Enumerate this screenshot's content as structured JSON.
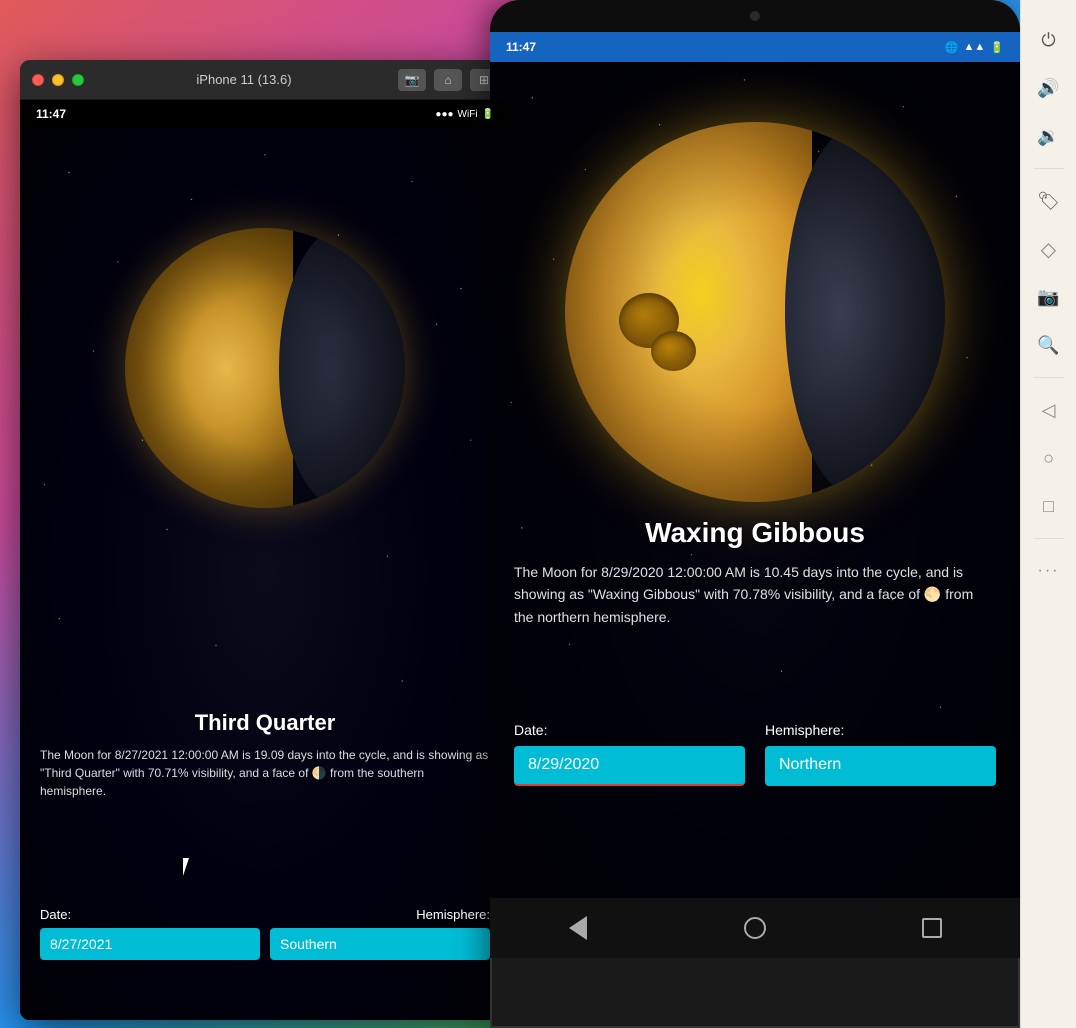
{
  "desktop": {
    "bg_description": "colorful gradient desktop background"
  },
  "ios_simulator": {
    "title": "iPhone 11 (13.6)",
    "screenshot_btn": "📷",
    "home_btn": "⌂",
    "apps_btn": "⊞",
    "status_time": "11:47",
    "moon_phase": "Third Quarter",
    "moon_description": "The Moon for 8/27/2021 12:00:00 AM is 19.09 days into the cycle, and is showing as \"Third Quarter\" with 70.71% visibility, and a face of 🌗  from the southern hemisphere.",
    "date_label": "Date:",
    "hemisphere_label": "Hemisphere:",
    "date_value": "8/27/2021",
    "hemisphere_value": "Southern"
  },
  "android_device": {
    "status_time": "11:47",
    "moon_phase": "Waxing Gibbous",
    "moon_description": "The Moon for 8/29/2020 12:00:00 AM is 10.45 days into the cycle, and is showing as \"Waxing Gibbous\" with 70.78% visibility, and a face of 🌕  from the northern hemisphere.",
    "date_label": "Date:",
    "hemisphere_label": "Hemisphere:",
    "date_value": "8/29/2020",
    "hemisphere_value": "Northern"
  },
  "toolbar": {
    "power_icon": "⏻",
    "volume_up_icon": "🔊",
    "volume_down_icon": "🔉",
    "tag_icon": "🏷",
    "eraser_icon": "◇",
    "camera_icon": "📷",
    "zoom_icon": "🔍",
    "back_icon": "◁",
    "circle_icon": "○",
    "square_icon": "□",
    "more_icon": "···"
  }
}
